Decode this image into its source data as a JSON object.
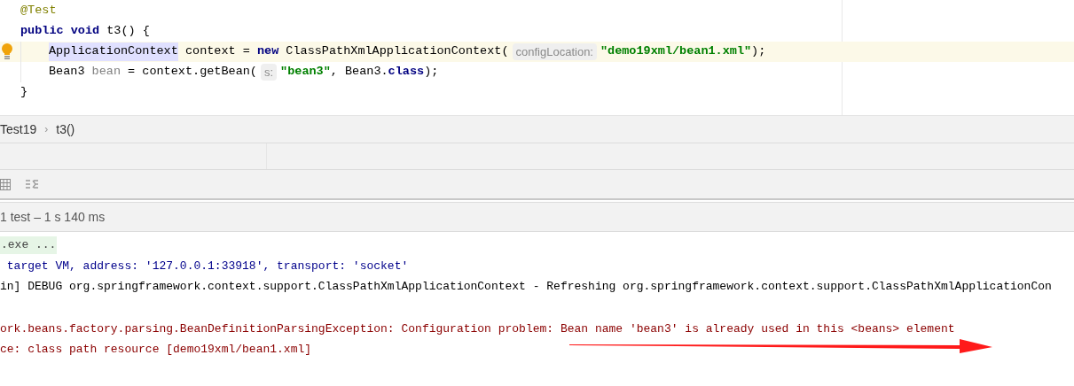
{
  "editor": {
    "lines": [
      {
        "highlighted": false,
        "intention": false,
        "tokens": [
          {
            "kind": "annotation",
            "text": "@Test"
          }
        ]
      },
      {
        "highlighted": false,
        "intention": false,
        "tokens": [
          {
            "kind": "keyword",
            "text": "public void"
          },
          {
            "kind": "plain",
            "text": " t3() {"
          }
        ],
        "children": [
          {
            "highlighted": true,
            "intention": true,
            "tokens": [
              {
                "kind": "match",
                "text": "ApplicationContext"
              },
              {
                "kind": "plain",
                "text": " context = "
              },
              {
                "kind": "keyword",
                "text": "new"
              },
              {
                "kind": "plain",
                "text": " ClassPathXmlApplicationContext("
              },
              {
                "kind": "hint",
                "text": "configLocation:"
              },
              {
                "kind": "string",
                "text": "\"demo19xml/bean1.xml\""
              },
              {
                "kind": "plain",
                "text": ");"
              }
            ]
          },
          {
            "highlighted": false,
            "intention": false,
            "tokens": [
              {
                "kind": "plain",
                "text": "Bean3 "
              },
              {
                "kind": "unused",
                "text": "bean"
              },
              {
                "kind": "plain",
                "text": " = context.getBean("
              },
              {
                "kind": "hint",
                "text": "s:"
              },
              {
                "kind": "string",
                "text": "\"bean3\""
              },
              {
                "kind": "plain",
                "text": ", Bean3."
              },
              {
                "kind": "keyword",
                "text": "class"
              },
              {
                "kind": "plain",
                "text": ");"
              }
            ]
          }
        ]
      },
      {
        "highlighted": false,
        "intention": false,
        "tokens": [
          {
            "kind": "plain",
            "text": "}"
          }
        ]
      }
    ]
  },
  "breadcrumb": [
    "Test19",
    "t3()"
  ],
  "breadcrumb_separator": "›",
  "test_summary": "1 test – 1 s 140 ms",
  "console": {
    "blocks": [
      {
        "lines": [
          {
            "kind": "folded",
            "text": ".exe ..."
          },
          {
            "kind": "system",
            "text": " target VM, address: '127.0.0.1:33918', transport: 'socket'"
          },
          {
            "kind": "normal",
            "text": "in] DEBUG org.springframework.context.support.ClassPathXmlApplicationContext - Refreshing org.springframework.context.support.ClassPathXmlApplicationCon"
          }
        ]
      },
      {
        "lines": [
          {
            "kind": "error",
            "text": "ork.beans.factory.parsing.BeanDefinitionParsingException: Configuration problem: Bean name 'bean3' is already used in this <beans> element"
          },
          {
            "kind": "error",
            "text": "ce: class path resource [demo19xml/bean1.xml]"
          }
        ]
      }
    ]
  }
}
